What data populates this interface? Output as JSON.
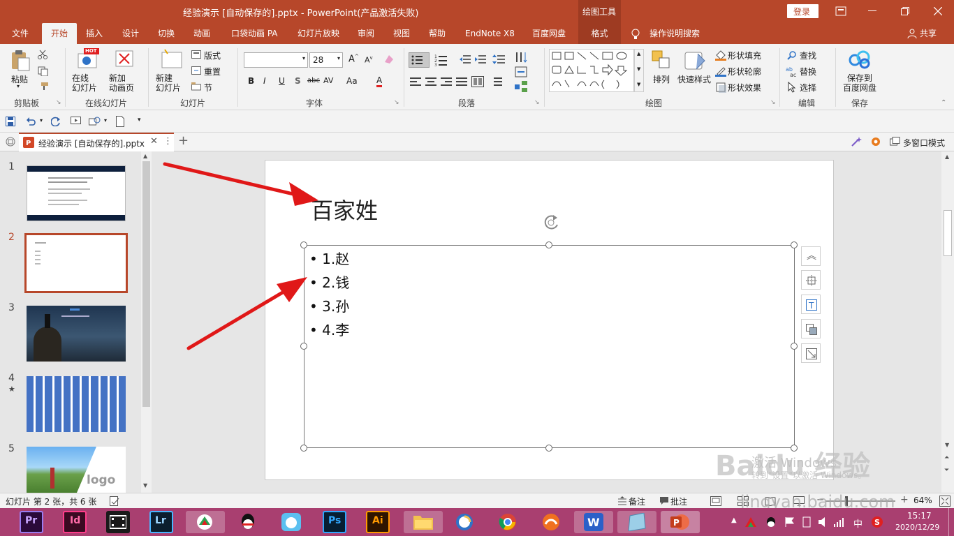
{
  "window": {
    "title": "经验演示 [自动保存的].pptx  -  PowerPoint(产品激活失败)",
    "context_group": "绘图工具",
    "login_label": "登录",
    "accent_color": "#b7472a"
  },
  "tabs": [
    "文件",
    "开始",
    "插入",
    "设计",
    "切换",
    "动画",
    "口袋动画 PA",
    "幻灯片放映",
    "审阅",
    "视图",
    "帮助",
    "EndNote X8",
    "百度网盘",
    "格式"
  ],
  "tab_active": "开始",
  "tell_me": "操作说明搜索",
  "share": "共享",
  "ribbon": {
    "clipboard": {
      "paste": "粘贴",
      "label": "剪贴板"
    },
    "online_slides": {
      "online_slide": "在线\n幻灯片",
      "hot": "HOT",
      "new_anim_page": "新加\n动画页",
      "label": "在线幻灯片"
    },
    "slides": {
      "new_slide": "新建\n幻灯片",
      "layout": "版式",
      "reset": "重置",
      "section": "节",
      "label": "幻灯片"
    },
    "font": {
      "font_name": "",
      "font_size": "28",
      "bold": "B",
      "italic": "I",
      "underline": "U",
      "shadow": "S",
      "strike": "abc",
      "spacing": "AV",
      "case": "Aa",
      "color": "A",
      "label": "字体"
    },
    "paragraph": {
      "label": "段落"
    },
    "drawing": {
      "arrange": "排列",
      "quick_styles": "快速样式",
      "shape_fill": "形状填充",
      "shape_outline": "形状轮廓",
      "shape_effects": "形状效果",
      "label": "绘图"
    },
    "editing": {
      "find": "查找",
      "replace": "替换",
      "select": "选择",
      "label": "编辑"
    },
    "save": {
      "save_to_baidu": "保存到\n百度网盘",
      "label": "保存"
    }
  },
  "doc_tab": {
    "name": "经验演示 [自动保存的].pptx",
    "multi_window": "多窗口模式"
  },
  "thumbnails": [
    {
      "num": "1",
      "star": ""
    },
    {
      "num": "2",
      "star": ""
    },
    {
      "num": "3",
      "star": ""
    },
    {
      "num": "4",
      "star": "★"
    },
    {
      "num": "5",
      "star": ""
    }
  ],
  "slide": {
    "title": "百家姓",
    "bullets": [
      "1.赵",
      "2.钱",
      "3.孙",
      "4.李"
    ],
    "watermark_line1": "激活 Windows",
    "watermark_line2": "转到\"设置\"以激活 Windows。"
  },
  "statusbar": {
    "slide_info": "幻灯片 第 2 张，共 6 张",
    "notes": "备注",
    "comments": "批注",
    "zoom": "64%"
  },
  "taskbar": {
    "apps": [
      "Pr",
      "Id",
      "video-editor",
      "Lr",
      "wps-app",
      "qq",
      "app-7",
      "Ps",
      "Ai",
      "file-explorer",
      "browser-360",
      "chrome",
      "app-13",
      "wps-office",
      "app-15",
      "powerpoint"
    ],
    "time": "15:17",
    "date": "2020/12/29",
    "ime": "中"
  },
  "watermark_site": "jingyan.baidu.com",
  "watermark_brand": "Baidu 经验"
}
